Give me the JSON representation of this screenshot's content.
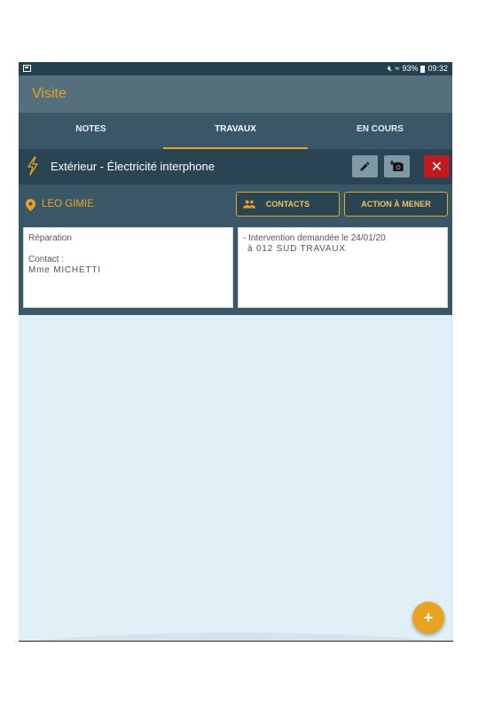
{
  "status_bar": {
    "left_icon": "image-icon",
    "icons": [
      "mute-icon",
      "wifi-icon"
    ],
    "battery": "93%",
    "battery_icon": "battery-icon",
    "time": "09:32"
  },
  "app_bar": {
    "title": "Visite"
  },
  "tabs": [
    {
      "label": "NOTES",
      "active": false
    },
    {
      "label": "TRAVAUX",
      "active": true
    },
    {
      "label": "EN COURS",
      "active": false
    }
  ],
  "job": {
    "icon": "bolt-icon",
    "title": "Extérieur - Électricité interphone",
    "actions": [
      {
        "name": "edit",
        "icon": "pencil-icon"
      },
      {
        "name": "add-photo",
        "icon": "add-camera-icon"
      },
      {
        "name": "delete",
        "icon": "close-icon"
      }
    ]
  },
  "client": {
    "icon": "location-pin-icon",
    "name": "LEO GIMIE",
    "contacts_button": "CONTACTS",
    "contacts_icon": "people-icon",
    "action_button": "ACTION À MENER"
  },
  "panels": {
    "left": {
      "line1": "Réparation",
      "contact_label": "Contact :",
      "contact_value": "Mme MICHETTI"
    },
    "right": {
      "line1": "- Intervention demandée le 24/01/20",
      "line2": "à 012 SUD TRAVAUX"
    }
  },
  "fab": {
    "label": "+",
    "icon": "add-icon"
  },
  "colors": {
    "accent": "#e8a321",
    "primary_dark": "#24404f",
    "primary": "#3a5767",
    "app_bar": "#566f7c",
    "delete": "#c0191f",
    "background": "#e1f0f7"
  }
}
